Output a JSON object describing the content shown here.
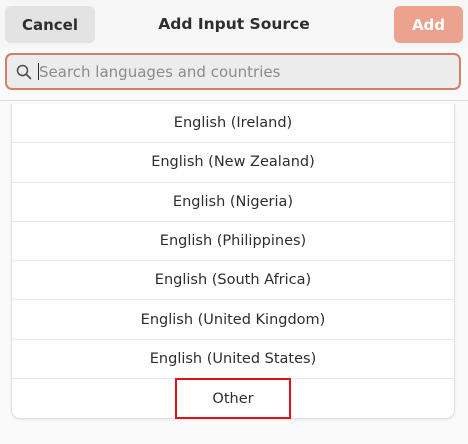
{
  "header": {
    "title": "Add Input Source",
    "cancel_label": "Cancel",
    "add_label": "Add"
  },
  "search": {
    "placeholder": "Search languages and countries",
    "value": ""
  },
  "list": {
    "items": [
      {
        "label": "English (Ireland)"
      },
      {
        "label": "English (New Zealand)"
      },
      {
        "label": "English (Nigeria)"
      },
      {
        "label": "English (Philippines)"
      },
      {
        "label": "English (South Africa)"
      },
      {
        "label": "English (United Kingdom)"
      },
      {
        "label": "English (United States)"
      },
      {
        "label": "Other"
      }
    ]
  },
  "colors": {
    "accent": "#eba28e",
    "search_border": "#d28068",
    "highlight": "#e0111b"
  },
  "icons": {
    "search": "search-icon"
  }
}
